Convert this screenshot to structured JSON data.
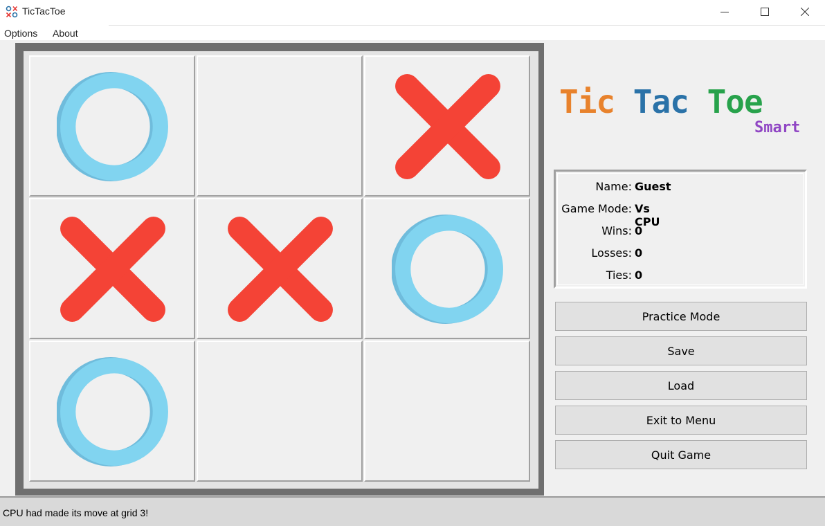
{
  "window": {
    "title": "TicTacToe",
    "controls": [
      "minimize-icon",
      "maximize-icon",
      "close-icon"
    ]
  },
  "menu": {
    "items": [
      "Options",
      "About"
    ]
  },
  "board": {
    "cells": [
      "O",
      "",
      "X",
      "X",
      "X",
      "O",
      "O",
      "",
      ""
    ],
    "colors": {
      "x": "#f44336",
      "o": "#81d4f0",
      "o_shade": "#6fbcdc"
    }
  },
  "logo": {
    "tic": "Tic",
    "tac": "Tac",
    "toe": "Toe",
    "subtitle": "Smart",
    "colors": {
      "tic": "#e8822c",
      "tac": "#2a72a8",
      "toe": "#27a24b",
      "subtitle": "#9046c4"
    }
  },
  "info": {
    "name_label": "Name:",
    "name_value": "Guest",
    "mode_label": "Game Mode:",
    "mode_value": "Vs CPU",
    "wins_label": "Wins:",
    "wins_value": "0",
    "losses_label": "Losses:",
    "losses_value": "0",
    "ties_label": "Ties:",
    "ties_value": "0"
  },
  "buttons": {
    "practice": "Practice Mode",
    "save": "Save",
    "load": "Load",
    "exit": "Exit to Menu",
    "quit": "Quit Game"
  },
  "status": {
    "message": "CPU had made its move at grid 3!"
  }
}
